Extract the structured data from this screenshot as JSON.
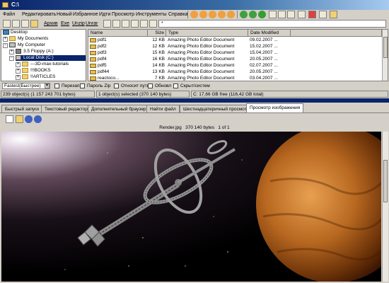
{
  "window": {
    "title": "C:\\"
  },
  "menu": [
    "Файл",
    "Редактировать",
    "Новый",
    "Избранное",
    "Идти",
    "Просмотр",
    "Инструменты",
    "Справка"
  ],
  "links": [
    "Архив",
    "Exe",
    "Unzip",
    "Unrar"
  ],
  "address": {
    "value": "*"
  },
  "tree": {
    "items": [
      {
        "label": "Desktop"
      },
      {
        "label": "My Documents"
      },
      {
        "label": "My Computer"
      },
      {
        "label": "3.5 Floppy (A:)"
      },
      {
        "label": "Local Disk (C:)"
      },
      {
        "label": "---3D-max-tutorials"
      },
      {
        "label": "!!!BOOKS"
      },
      {
        "label": "!!ARTICLES"
      }
    ]
  },
  "files": {
    "columns": [
      "Name",
      "Size",
      "Type",
      "Date Modified"
    ],
    "rows": [
      {
        "name": "pdf1",
        "size": "12 KB",
        "type": "Amazing Photo Editor Document",
        "date": "09.02.2007 ..."
      },
      {
        "name": "pdf2",
        "size": "12 KB",
        "type": "Amazing Photo Editor Document",
        "date": "15.02.2007 ..."
      },
      {
        "name": "pdf3",
        "size": "15 KB",
        "type": "Amazing Photo Editor Document",
        "date": "15.04.2007 ..."
      },
      {
        "name": "pdf4",
        "size": "16 KB",
        "type": "Amazing Photo Editor Document",
        "date": "20.05.2007 ..."
      },
      {
        "name": "pdf5",
        "size": "14 KB",
        "type": "Amazing Photo Editor Document",
        "date": "02.07.2007 ..."
      },
      {
        "name": "pdf44",
        "size": "13 KB",
        "type": "Amazing Photo Editor Document",
        "date": "20.05.2007 ..."
      },
      {
        "name": "reactoco...",
        "size": "7 KB",
        "type": "Amazing Photo Editor Document",
        "date": "03.04.2007 ..."
      }
    ]
  },
  "options": {
    "compression": "Fastest(Быстрее)",
    "checkboxes": [
      "Перезап",
      "Пароль Zip",
      "Относит путь",
      "Обновл",
      "Скрыт/систем"
    ]
  },
  "status": {
    "total": "239 object(s) (1 157 243 701 bytes)",
    "selected": "1 object(s) selected (370 140 bytes)",
    "disk": "C: 17,66 GB free (116,42 GB total)"
  },
  "tabs": [
    "Быстрый запуск",
    "Текстовый редактор",
    "Дополнительный браузер",
    "Найти файл",
    "Шестнадцатеричный просмотр",
    "Просмотр изображения"
  ],
  "viewer": {
    "file_info": "Render.jpg   370 140 bytes   1 of 1"
  },
  "colors": {
    "titlebar": "#0a246a",
    "selection": "#0a246a",
    "face": "#d4d0c8"
  }
}
